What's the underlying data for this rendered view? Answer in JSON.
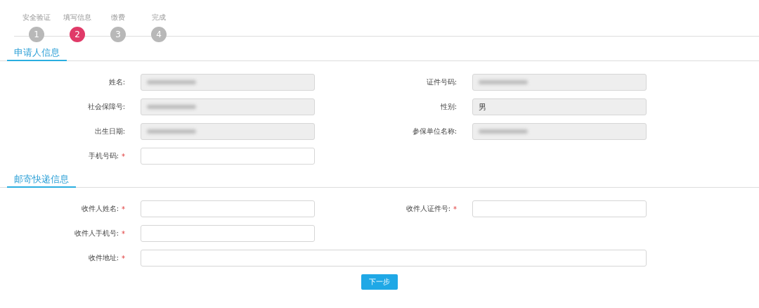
{
  "steps": [
    {
      "label": "安全验证",
      "number": "1",
      "selected": false
    },
    {
      "label": "填写信息",
      "number": "2",
      "selected": true
    },
    {
      "label": "缴费",
      "number": "3",
      "selected": false
    },
    {
      "label": "完成",
      "number": "4",
      "selected": false
    }
  ],
  "sections": [
    {
      "title": "申请人信息",
      "rows": [
        [
          {
            "label": "姓名:",
            "kind": "readonly",
            "redacted": true
          },
          {
            "label": "证件号码:",
            "kind": "readonly",
            "redacted": true
          }
        ],
        [
          {
            "label": "社会保障号:",
            "kind": "readonly",
            "redacted": true
          },
          {
            "label": "性别:",
            "kind": "readonly",
            "value": "男"
          }
        ],
        [
          {
            "label": "出生日期:",
            "kind": "readonly",
            "redacted": true
          },
          {
            "label": "参保单位名称:",
            "kind": "readonly",
            "redacted": true
          }
        ],
        [
          {
            "label": "手机号码:",
            "kind": "input",
            "required_mark": "*"
          }
        ]
      ]
    },
    {
      "title": "邮寄快递信息",
      "rows": [
        [
          {
            "label": "收件人姓名:",
            "kind": "input",
            "required_mark": "*"
          },
          {
            "label": "收件人证件号:",
            "kind": "input",
            "required_mark": "*"
          }
        ],
        [
          {
            "label": "收件人手机号:",
            "kind": "input",
            "required_mark": "*"
          }
        ],
        [
          {
            "label": "收件地址:",
            "kind": "input",
            "required_mark": "*",
            "wide": true
          }
        ]
      ]
    }
  ],
  "next_button": "下一步"
}
